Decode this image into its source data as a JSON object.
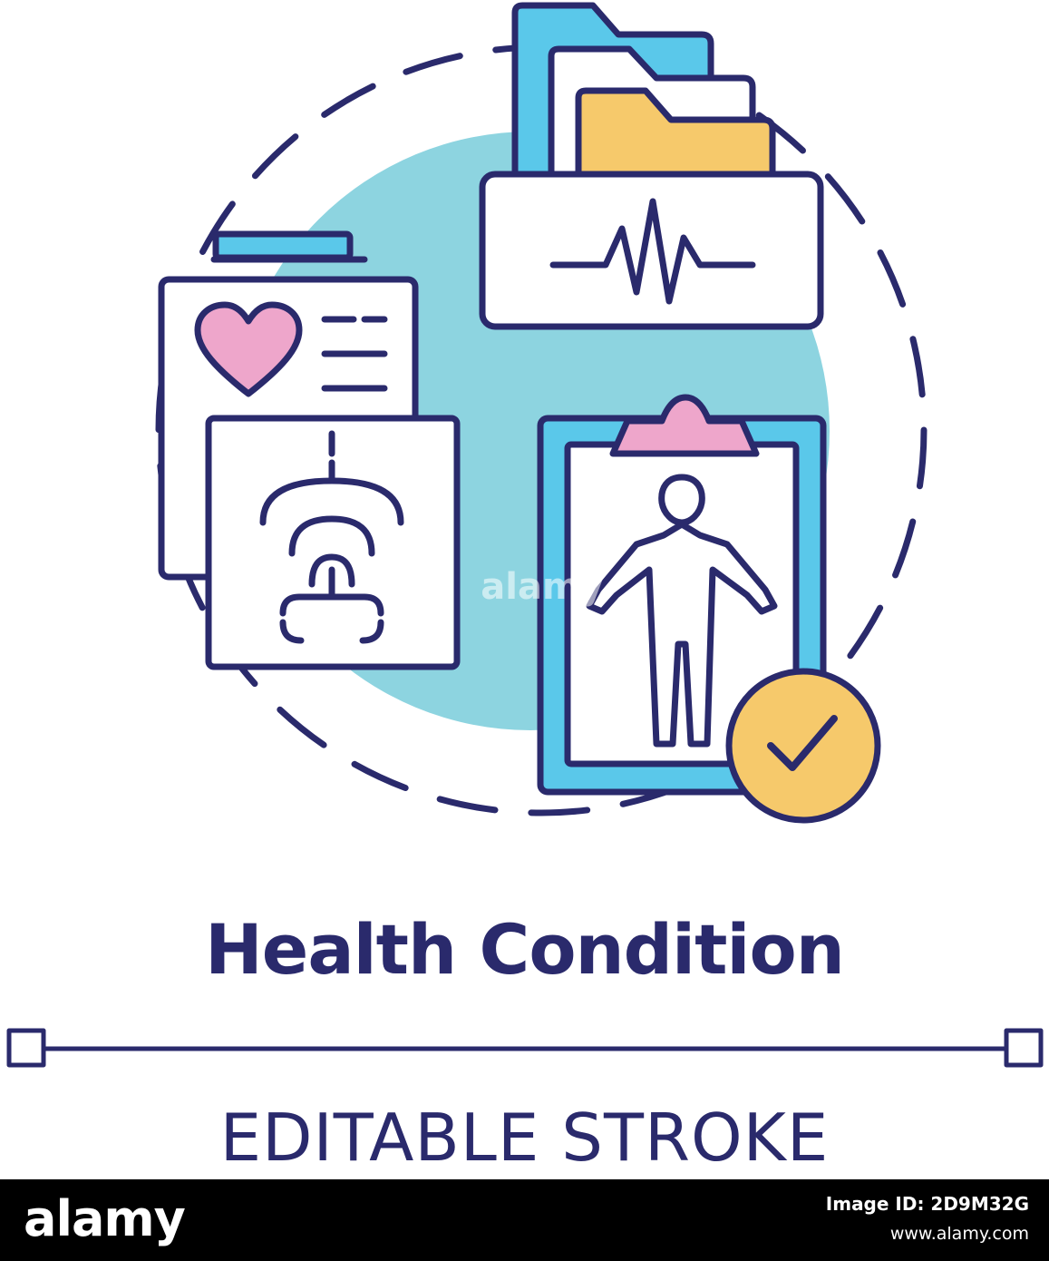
{
  "title": "Health Condition",
  "subtitle": "EDITABLE STROKE",
  "watermark": "alamy",
  "footer": {
    "brand": "alamy",
    "image_id": "Image ID: 2D9M32G",
    "url": "www.alamy.com"
  },
  "icons": {
    "circle": "dashed-circle-icon",
    "folder": "medical-folder-icon",
    "pulse": "heartbeat-pulse-icon",
    "heart": "heart-icon",
    "xray": "xray-chest-icon",
    "clipboard": "clipboard-icon",
    "person": "human-body-icon",
    "check": "checkmark-icon"
  },
  "colors": {
    "stroke": "#2a2a6c",
    "blob": "#8dd4e0",
    "blue": "#5ac8ea",
    "yellow": "#f6c96b",
    "pink": "#eea6cb",
    "white": "#ffffff",
    "text": "#2a2a6c",
    "footer_bg": "#000000"
  }
}
